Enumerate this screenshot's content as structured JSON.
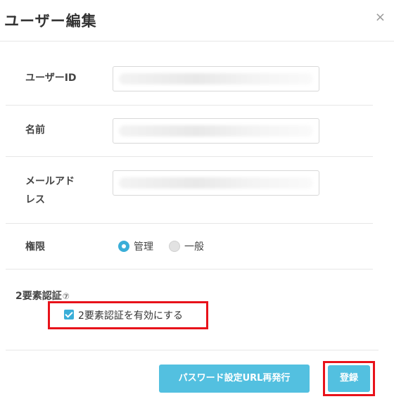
{
  "dialog": {
    "title": "ユーザー編集",
    "close_label": "×"
  },
  "form": {
    "user_id": {
      "label": "ユーザーID",
      "value": ""
    },
    "name": {
      "label": "名前",
      "value": ""
    },
    "email": {
      "label_line1": "メールアド",
      "label_line2": "レス",
      "value": ""
    },
    "role": {
      "label": "権限",
      "options": [
        {
          "label": "管理",
          "selected": true
        },
        {
          "label": "一般",
          "selected": false
        }
      ]
    },
    "two_factor": {
      "title": "2要素認証",
      "help_icon": "question-circle-icon",
      "checkbox_label": "2要素認証を有効にする",
      "checked": true
    }
  },
  "footer": {
    "reissue_label": "パスワード設定URL再発行",
    "save_label": "登録"
  },
  "colors": {
    "accent": "#3aaed8",
    "button": "#53c0e0",
    "highlight": "#e8121a"
  }
}
